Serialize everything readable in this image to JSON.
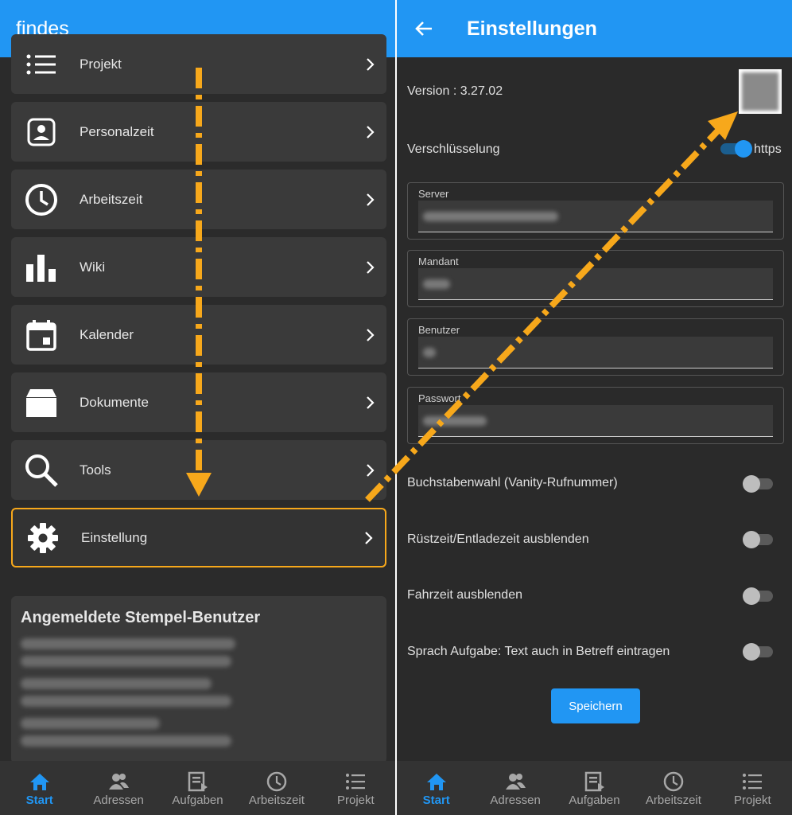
{
  "left": {
    "app_title": "findes",
    "menu": [
      {
        "label": "Projekt",
        "icon": "list-icon"
      },
      {
        "label": "Personalzeit",
        "icon": "badge-icon"
      },
      {
        "label": "Arbeitszeit",
        "icon": "clock-icon"
      },
      {
        "label": "Wiki",
        "icon": "bar-chart-icon"
      },
      {
        "label": "Kalender",
        "icon": "calendar-icon"
      },
      {
        "label": "Dokumente",
        "icon": "box-icon"
      },
      {
        "label": "Tools",
        "icon": "search-icon"
      },
      {
        "label": "Einstellung",
        "icon": "gear-icon"
      }
    ],
    "selected_item": "Einstellung",
    "stempel_heading": "Angemeldete Stempel-Benutzer"
  },
  "right": {
    "title": "Einstellungen",
    "version_label": "Version : 3.27.02",
    "encryption_label": "Verschlüsselung",
    "encryption_value": "https",
    "encryption_on": true,
    "fields": [
      {
        "label": "Server"
      },
      {
        "label": "Mandant"
      },
      {
        "label": "Benutzer"
      },
      {
        "label": "Passwort"
      }
    ],
    "switches": [
      {
        "label": "Buchstabenwahl (Vanity-Rufnummer)",
        "on": false
      },
      {
        "label": "Rüstzeit/Entladezeit ausblenden",
        "on": false
      },
      {
        "label": "Fahrzeit ausblenden",
        "on": false
      },
      {
        "label": "Sprach Aufgabe: Text auch in Betreff eintragen",
        "on": false
      }
    ],
    "save_label": "Speichern"
  },
  "nav": [
    {
      "label": "Start",
      "icon": "home-icon",
      "active": true
    },
    {
      "label": "Adressen",
      "icon": "people-icon",
      "active": false
    },
    {
      "label": "Aufgaben",
      "icon": "tasks-icon",
      "active": false
    },
    {
      "label": "Arbeitszeit",
      "icon": "clock-icon",
      "active": false
    },
    {
      "label": "Projekt",
      "icon": "list-icon",
      "active": false
    }
  ],
  "colors": {
    "accent": "#2196f3",
    "highlight": "#f7a81b",
    "background": "#2b2b2b",
    "card": "#3a3a3a"
  }
}
